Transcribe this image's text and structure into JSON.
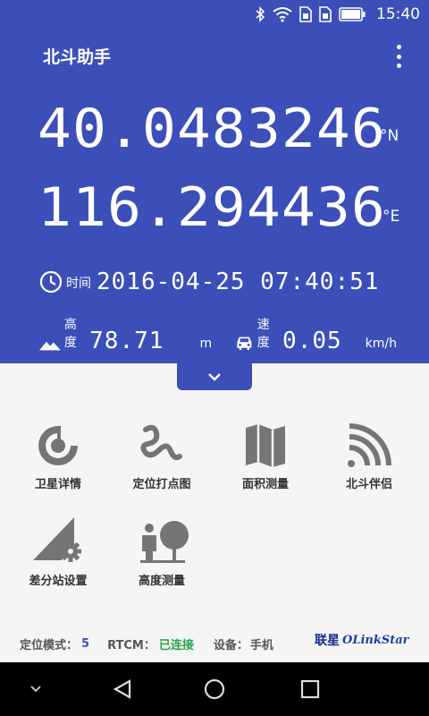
{
  "status": {
    "time": "15:40"
  },
  "header": {
    "title": "北斗助手"
  },
  "position": {
    "latitude": "40.0483246",
    "latitude_unit": "°N",
    "longitude": "116.294436",
    "longitude_unit": "°E"
  },
  "time": {
    "label": "时间",
    "value": "2016-04-25 07:40:51"
  },
  "altitude": {
    "label": "高度",
    "value": "78.71",
    "unit": "m"
  },
  "speed": {
    "label": "速度",
    "value": "0.05",
    "unit": "km/h"
  },
  "tools": [
    {
      "label": "卫星详情",
      "icon": "satellite-icon"
    },
    {
      "label": "定位打点图",
      "icon": "track-icon"
    },
    {
      "label": "面积测量",
      "icon": "map-icon"
    },
    {
      "label": "北斗伴侣",
      "icon": "signal-icon"
    },
    {
      "label": "差分站设置",
      "icon": "base-station-settings-icon"
    },
    {
      "label": "高度测量",
      "icon": "height-measure-icon"
    }
  ],
  "info": {
    "mode_label": "定位模式：",
    "mode_value": "5",
    "rtcm_label": "RTCM：",
    "rtcm_value": "已连接",
    "device_label": "设备：",
    "device_value": "手机"
  },
  "brand": {
    "cn": "联星",
    "en": "OLinkStar"
  },
  "colors": {
    "primary": "#3c4fb8",
    "icon_gray": "#757575",
    "connected": "#2aa34a"
  }
}
